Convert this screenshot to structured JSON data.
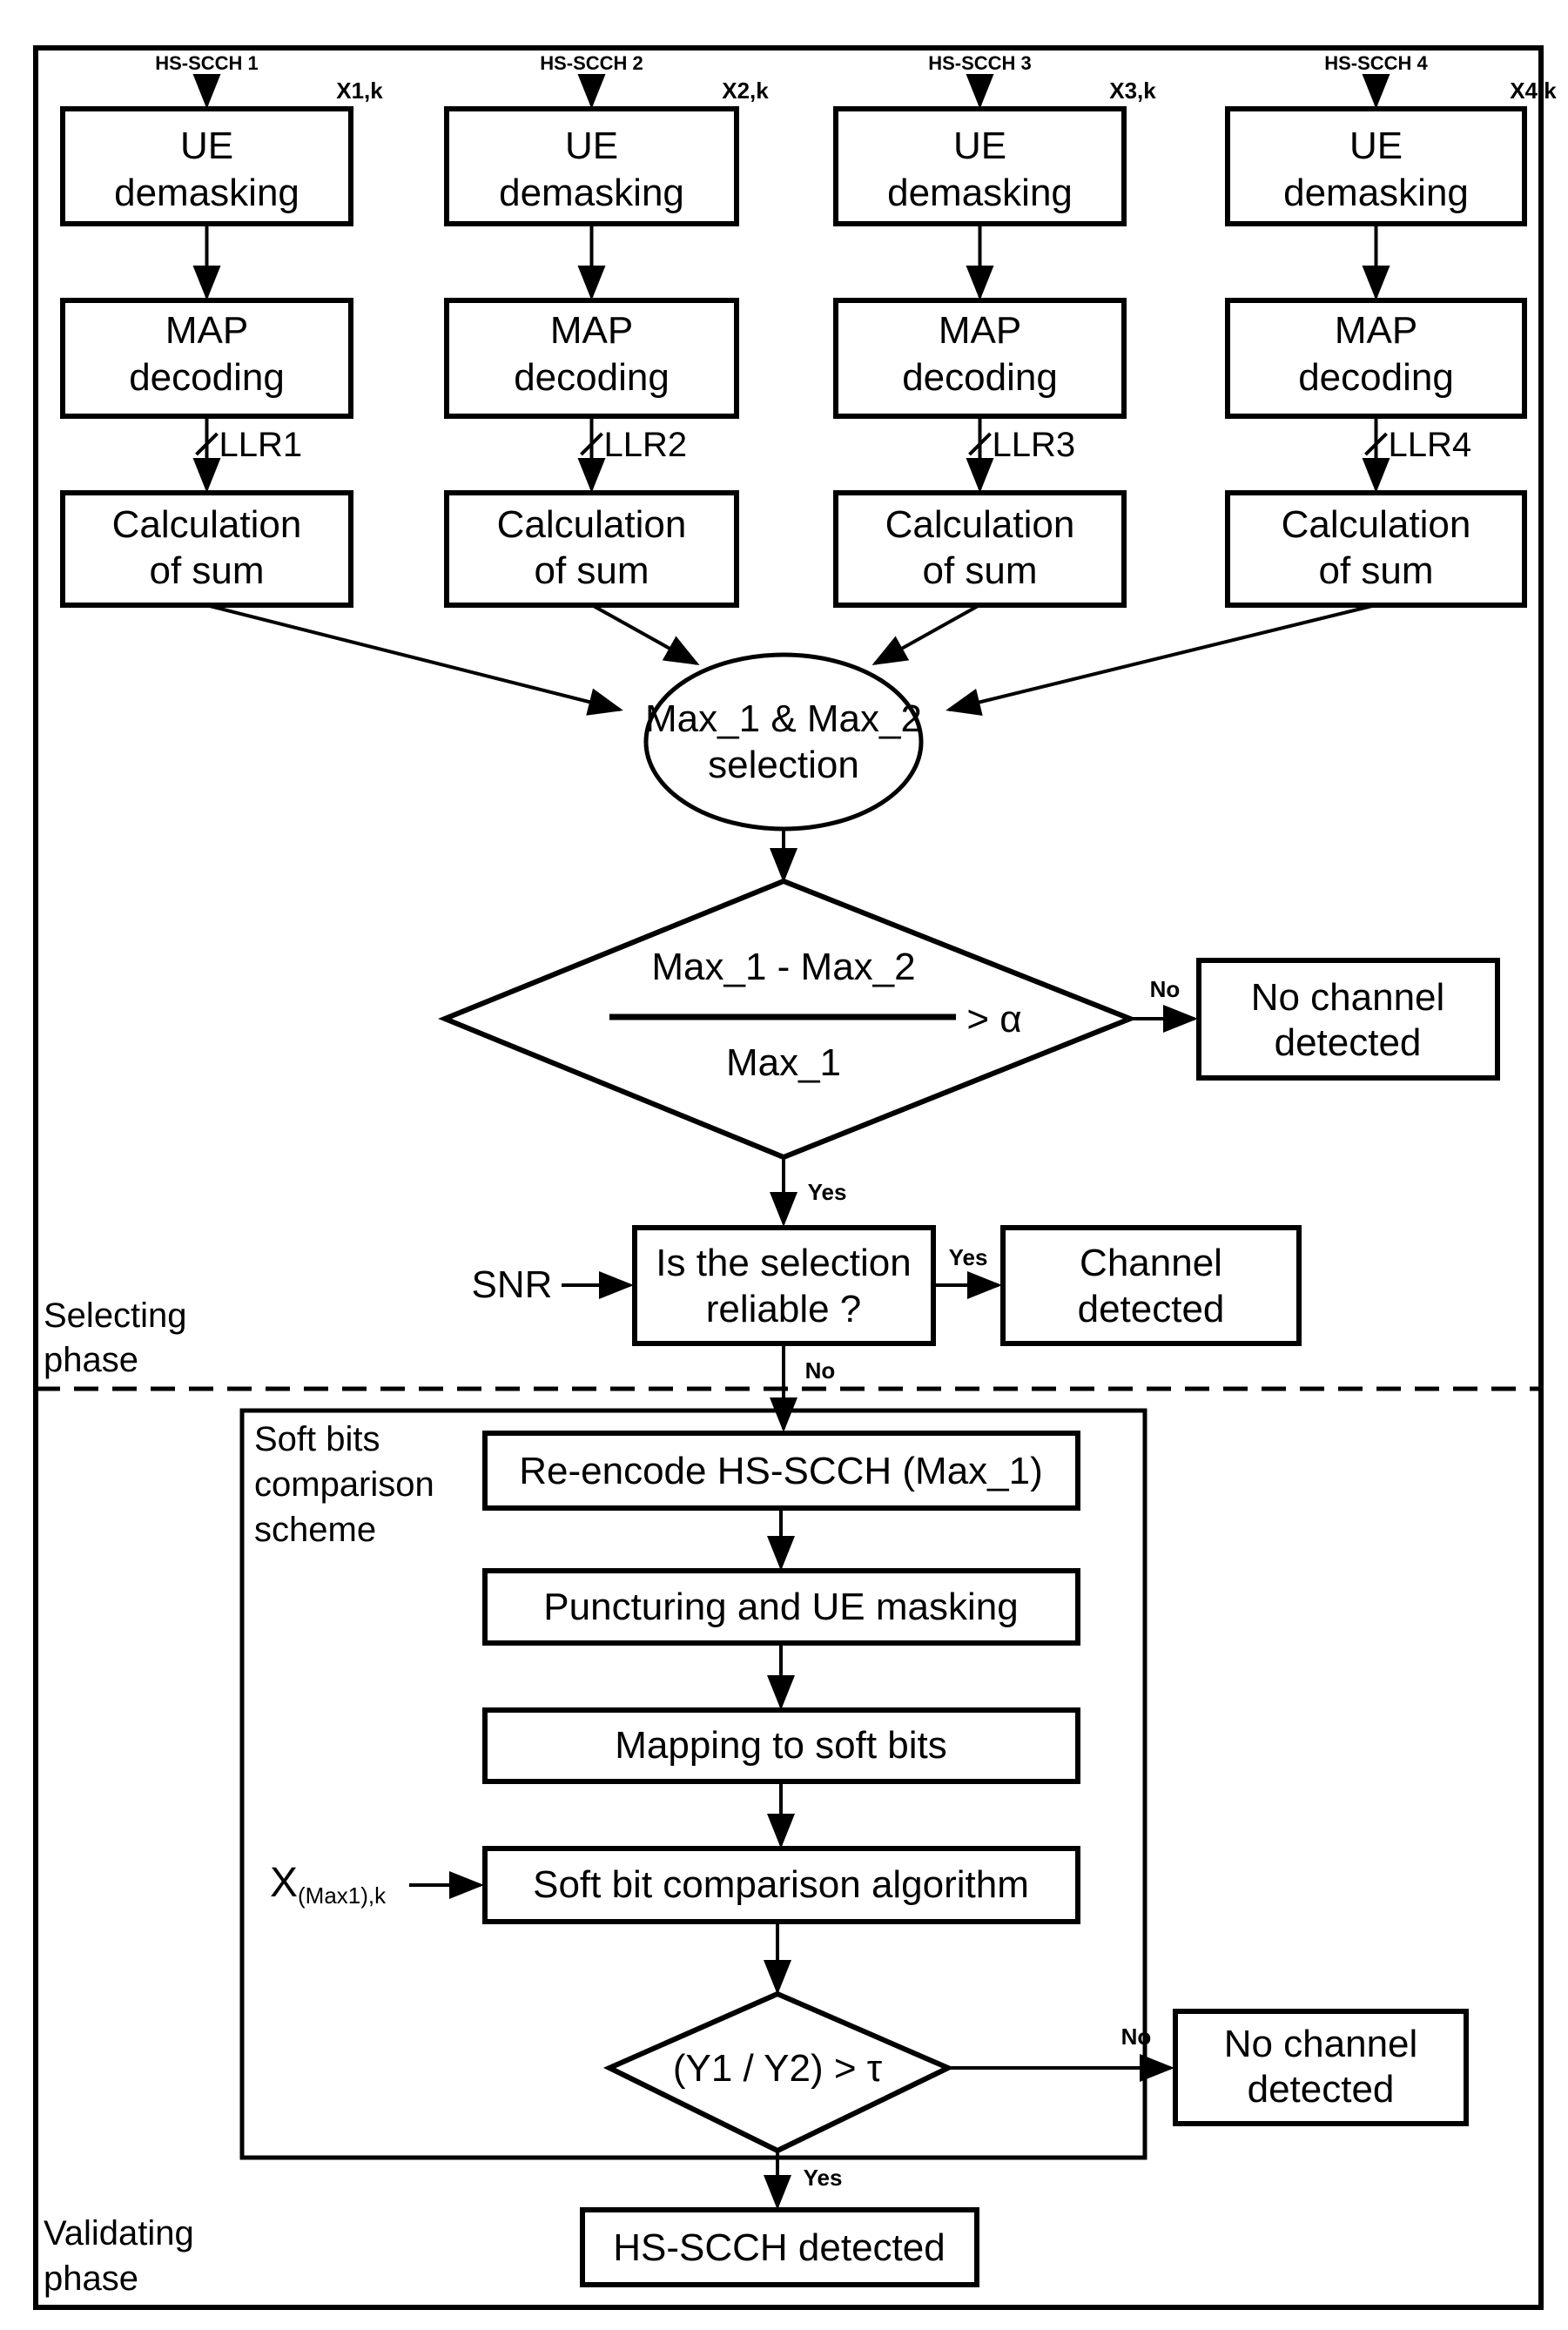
{
  "diagram": {
    "channels": [
      {
        "input": "HS-SCCH 1",
        "signal": "X1,k",
        "llr": "LLR1"
      },
      {
        "input": "HS-SCCH 2",
        "signal": "X2,k",
        "llr": "LLR2"
      },
      {
        "input": "HS-SCCH 3",
        "signal": "X3,k",
        "llr": "LLR3"
      },
      {
        "input": "HS-SCCH 4",
        "signal": "X4,k",
        "llr": "LLR4"
      }
    ],
    "blocks": {
      "ue_demasking": [
        "UE",
        "demasking"
      ],
      "map_decoding": [
        "MAP",
        "decoding"
      ],
      "calc_sum": [
        "Calculation",
        "of sum"
      ]
    },
    "selection": [
      "Max_1 & Max_2",
      "selection"
    ],
    "ratio_test": {
      "numerator": "Max_1 - Max_2",
      "denominator": "Max_1",
      "comparator": "> α",
      "no_label": "No",
      "yes_label": "Yes"
    },
    "no_channel_1": [
      "No channel",
      "detected"
    ],
    "snr_label": "SNR",
    "reliable_check": [
      "Is the selection",
      "reliable ?"
    ],
    "reliable_yes": "Yes",
    "reliable_no": "No",
    "channel_detected": [
      "Channel",
      "detected"
    ],
    "selecting_phase": [
      "Selecting",
      "phase"
    ],
    "soft_bits_scheme": [
      "Soft bits",
      "comparison",
      "scheme"
    ],
    "reencode": "Re-encode HS-SCCH (Max_1)",
    "puncturing": "Puncturing and UE masking",
    "mapping": "Mapping to soft bits",
    "soft_compare": "Soft bit comparison algorithm",
    "x_input": {
      "main": "X",
      "sub": "(Max1),k"
    },
    "tau_test": "(Y1 / Y2) > τ",
    "tau_no": "No",
    "tau_yes": "Yes",
    "no_channel_2": [
      "No channel",
      "detected"
    ],
    "hs_scch_detected": "HS-SCCH detected",
    "validating_phase": [
      "Validating",
      "phase"
    ]
  }
}
